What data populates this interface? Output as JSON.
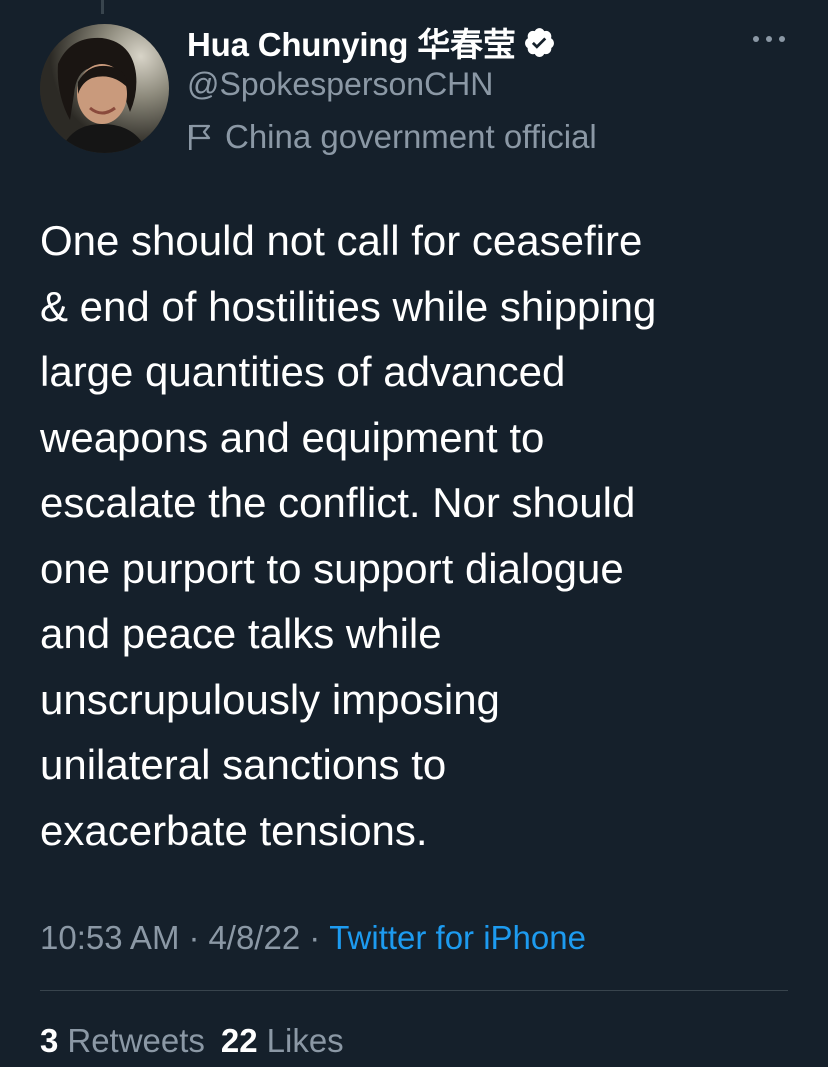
{
  "author": {
    "display_name": "Hua Chunying 华春莹",
    "handle": "@SpokespersonCHN",
    "label": "China government official",
    "verified": true,
    "avatar_icon": "profile-photo"
  },
  "tweet": {
    "text_lines": [
      "One should not call for ceasefire",
      "& end of hostilities while shipping",
      "large quantities of advanced",
      "weapons and equipment to",
      "escalate the conflict. Nor should",
      "one purport to support dialogue",
      "and peace talks while",
      "unscrupulously imposing",
      "unilateral sanctions to",
      "exacerbate tensions."
    ]
  },
  "meta": {
    "time": "10:53 AM",
    "separator": "·",
    "date": "4/8/22",
    "source": "Twitter for iPhone"
  },
  "stats": {
    "retweets_count": "3",
    "retweets_label": "Retweets",
    "likes_count": "22",
    "likes_label": "Likes"
  },
  "colors": {
    "background": "#15202b",
    "text_primary": "#ffffff",
    "text_secondary": "#8b98a5",
    "accent": "#1d9bf0",
    "divider": "#38444d"
  },
  "icons": {
    "verified": "verified-badge-icon",
    "label": "flag-icon",
    "more": "more-options-icon"
  }
}
